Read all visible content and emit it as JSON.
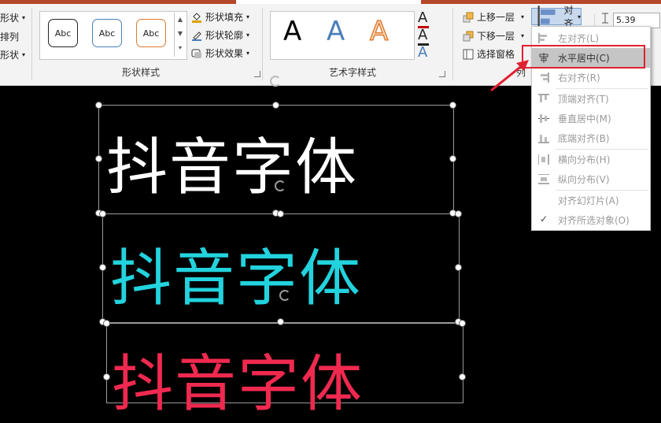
{
  "ribbon": {
    "left_partial": [
      "形状",
      "排列",
      "形状"
    ],
    "shape_style_samples": [
      "Abc",
      "Abc",
      "Abc"
    ],
    "shape_fill": "形状填充",
    "shape_outline": "形状轮廓",
    "shape_effects": "形状效果",
    "shape_styles_group": "形状样式",
    "wordart_samples": [
      "A",
      "A",
      "A"
    ],
    "wordart_group": "艺术字样式",
    "bring_forward": "上移一层",
    "send_backward": "下移一层",
    "selection_pane": "选择窗格",
    "align_button": "对齐",
    "size_value": "5.39",
    "arrange_group_partial": "列"
  },
  "align_menu": {
    "items": [
      {
        "label": "左对齐(L)",
        "icon": "align-left-icon"
      },
      {
        "label": "水平居中(C)",
        "icon": "align-center-icon"
      },
      {
        "label": "右对齐(R)",
        "icon": "align-right-icon"
      },
      {
        "label": "顶端对齐(T)",
        "icon": "align-top-icon"
      },
      {
        "label": "垂直居中(M)",
        "icon": "align-middle-icon"
      },
      {
        "label": "底端对齐(B)",
        "icon": "align-bottom-icon"
      },
      {
        "label": "横向分布(H)",
        "icon": "distribute-horizontal-icon"
      },
      {
        "label": "纵向分布(V)",
        "icon": "distribute-vertical-icon"
      },
      {
        "label": "对齐幻灯片(A)",
        "icon": ""
      },
      {
        "label": "对齐所选对象(O)",
        "icon": "check-icon"
      }
    ]
  },
  "canvas": {
    "text_boxes": [
      {
        "text": "抖音字体",
        "color": "#ffffff"
      },
      {
        "text": "抖音字体",
        "color": "#22d3de"
      },
      {
        "text": "抖音字体",
        "color": "#f0294f"
      }
    ]
  },
  "colors": {
    "accent_red": "#b7472a",
    "annotation_red": "#e02030",
    "menu_highlight": "#c5c5c5"
  }
}
